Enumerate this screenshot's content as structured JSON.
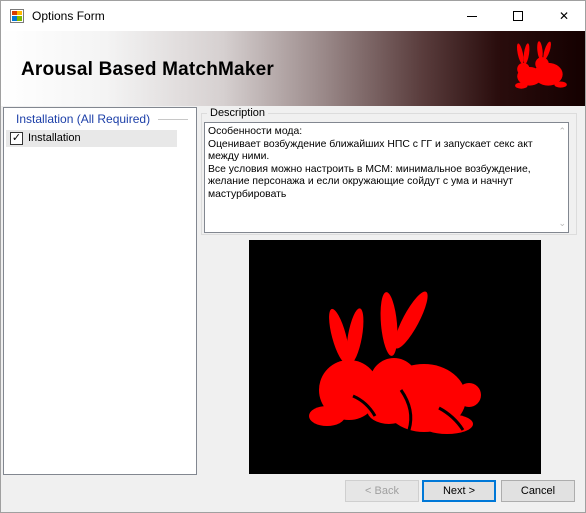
{
  "window": {
    "title": "Options Form",
    "controls": {
      "minimize": "minimize",
      "maximize": "maximize",
      "close": "✕"
    }
  },
  "banner": {
    "title": "Arousal Based MatchMaker",
    "logo_icon": "red-rabbits-logo"
  },
  "install_steps": {
    "group_name": "Installation (All Required)",
    "items": [
      {
        "label": "Installation",
        "checked": true
      }
    ]
  },
  "description": {
    "legend": "Description",
    "text": "Особенности мода:\nОценивает возбуждение ближайших НПС с ГГ и запускает секс акт между ними.\nВсе условия можно настроить в МСМ: минимальное возбуждение, желание персонажа и если окружающие сойдут с ума и начнут мастурбировать"
  },
  "preview": {
    "background": "#000000",
    "figure_color": "#ff0000",
    "icon": "red-rabbits-image"
  },
  "buttons": {
    "back": "< Back",
    "next": "Next >",
    "cancel": "Cancel"
  },
  "colors": {
    "accent": "#0078d7",
    "group_header": "#1c3fa8",
    "rabbit_red": "#ff0000"
  }
}
